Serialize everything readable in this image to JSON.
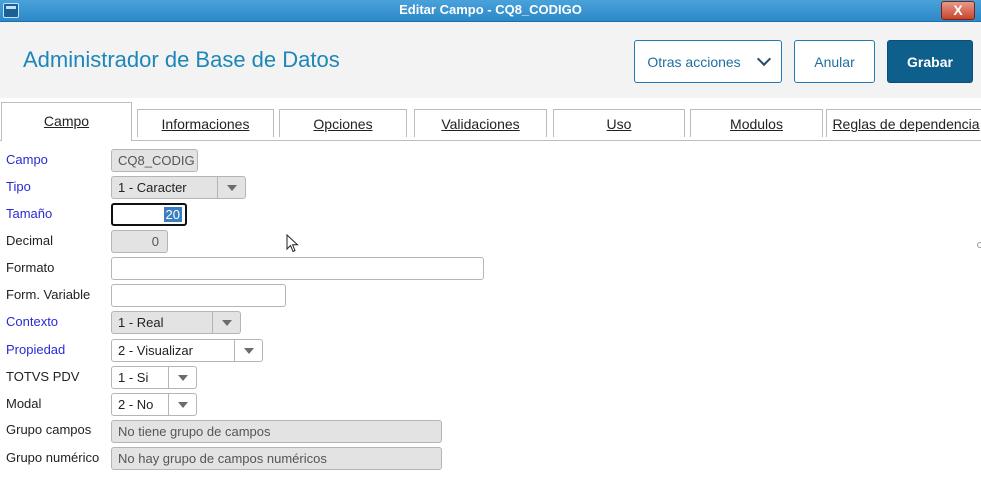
{
  "window": {
    "title": "Editar Campo - CQ8_CODIGO",
    "close_label": "X"
  },
  "header": {
    "title": "Administrador de Base de Datos",
    "more_actions": "Otras acciones",
    "cancel": "Anular",
    "save": "Grabar"
  },
  "tabs": [
    {
      "label": "Campo"
    },
    {
      "label": "Informaciones"
    },
    {
      "label": "Opciones"
    },
    {
      "label": "Validaciones"
    },
    {
      "label": "Uso"
    },
    {
      "label": "Modulos"
    },
    {
      "label": "Reglas de dependencia"
    }
  ],
  "form": {
    "campo": {
      "label": "Campo",
      "value": "CQ8_CODIG"
    },
    "tipo": {
      "label": "Tipo",
      "value": "1 - Caracter"
    },
    "tamano": {
      "label": "Tamaño",
      "value": "20"
    },
    "decimal": {
      "label": "Decimal",
      "value": "0"
    },
    "formato": {
      "label": "Formato",
      "value": ""
    },
    "form_variable": {
      "label": "Form. Variable",
      "value": ""
    },
    "contexto": {
      "label": "Contexto",
      "value": "1 - Real"
    },
    "propiedad": {
      "label": "Propiedad",
      "value": "2 - Visualizar"
    },
    "totvs_pdv": {
      "label": "TOTVS PDV",
      "value": "1 - Si"
    },
    "modal": {
      "label": "Modal",
      "value": "2 - No"
    },
    "grupo_campos": {
      "label": "Grupo campos",
      "value": "No tiene grupo de campos"
    },
    "grupo_numerico": {
      "label": "Grupo numérico",
      "value": "No hay grupo de campos numéricos"
    }
  },
  "colors": {
    "accent": "#1c87b8",
    "save_button": "#0f5f8d",
    "required_label": "#2a2ad6",
    "titlebar": "#3b95d2"
  }
}
